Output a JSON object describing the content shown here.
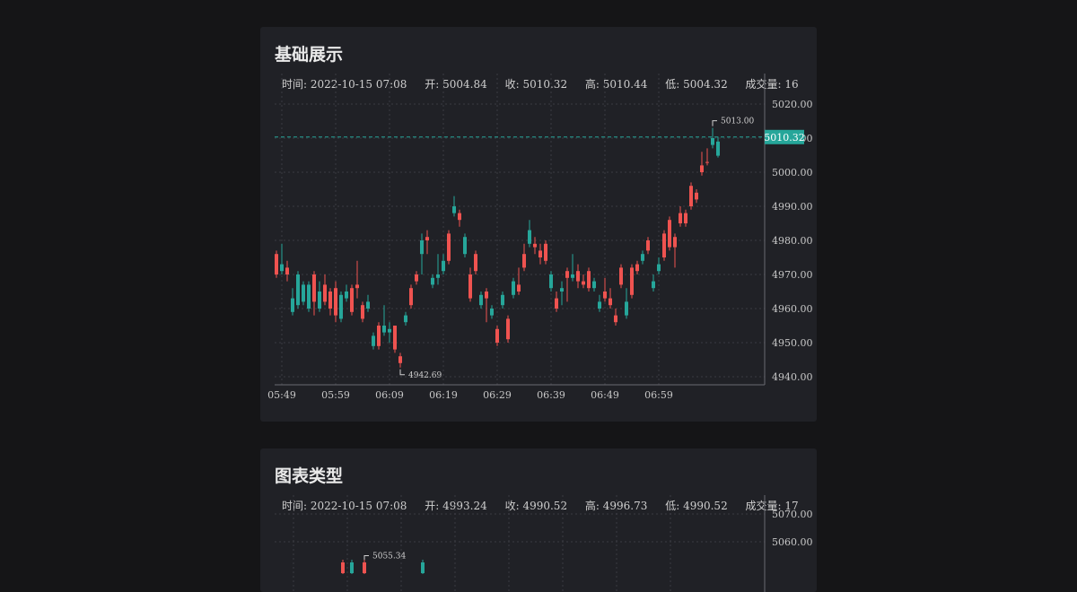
{
  "panels": [
    {
      "title": "基础展示",
      "tooltip": {
        "time": "时间: 2022-10-15 07:08",
        "open": "开: 5004.84",
        "close": "收: 5010.32",
        "high": "高: 5010.44",
        "low": "低: 5004.32",
        "volume": "成交量: 16"
      }
    },
    {
      "title": "图表类型",
      "tooltip": {
        "time": "时间: 2022-10-15 07:08",
        "open": "开: 4993.24",
        "close": "收: 4990.52",
        "high": "高: 4996.73",
        "low": "低: 4990.52",
        "volume": "成交量: 17"
      }
    }
  ],
  "chart_data": [
    {
      "type": "candlestick",
      "title": "基础展示",
      "ylim": [
        4935,
        5025
      ],
      "y_ticks": [
        4940,
        4950,
        4960,
        4970,
        4980,
        4990,
        5000,
        5010,
        5020
      ],
      "y_tick_labels": [
        "4940.00",
        "4950.00",
        "4960.00",
        "4970.00",
        "4980.00",
        "4990.00",
        "5000.00",
        "5010.00",
        "5020.00"
      ],
      "x_tick_labels": [
        "05:49",
        "05:59",
        "06:09",
        "06:19",
        "06:29",
        "06:39",
        "06:49",
        "06:59"
      ],
      "x_tick_index": [
        1,
        11,
        21,
        31,
        41,
        51,
        61,
        71
      ],
      "last_price": 5010.32,
      "last_price_label": "5010.32",
      "max_label": "5013.00",
      "max_index": 81,
      "max_value": 5013.0,
      "min_label": "4942.69",
      "min_index": 23,
      "min_value": 4942.69,
      "up_color": "#ef5350",
      "down_color": "#26a69a",
      "candles": [
        {
          "o": 4970,
          "c": 4976,
          "h": 4977,
          "l": 4969
        },
        {
          "o": 4973,
          "c": 4971,
          "h": 4979,
          "l": 4970
        },
        {
          "o": 4970,
          "c": 4972,
          "h": 4974,
          "l": 4968
        },
        {
          "o": 4963,
          "c": 4959,
          "h": 4966,
          "l": 4958
        },
        {
          "o": 4970,
          "c": 4961,
          "h": 4971,
          "l": 4960
        },
        {
          "o": 4967,
          "c": 4962,
          "h": 4968,
          "l": 4961
        },
        {
          "o": 4967,
          "c": 4960,
          "h": 4968,
          "l": 4959
        },
        {
          "o": 4962,
          "c": 4970,
          "h": 4971,
          "l": 4958
        },
        {
          "o": 4965,
          "c": 4960,
          "h": 4968,
          "l": 4959
        },
        {
          "o": 4962,
          "c": 4967,
          "h": 4970,
          "l": 4961
        },
        {
          "o": 4960,
          "c": 4965,
          "h": 4966,
          "l": 4958
        },
        {
          "o": 4958,
          "c": 4966,
          "h": 4968,
          "l": 4956
        },
        {
          "o": 4964,
          "c": 4957,
          "h": 4965,
          "l": 4956
        },
        {
          "o": 4965,
          "c": 4963,
          "h": 4967,
          "l": 4962
        },
        {
          "o": 4959,
          "c": 4966,
          "h": 4967,
          "l": 4958
        },
        {
          "o": 4966,
          "c": 4967,
          "h": 4974,
          "l": 4963
        },
        {
          "o": 4957,
          "c": 4961,
          "h": 4962,
          "l": 4956
        },
        {
          "o": 4962,
          "c": 4960,
          "h": 4964,
          "l": 4959
        },
        {
          "o": 4952,
          "c": 4949,
          "h": 4953,
          "l": 4948
        },
        {
          "o": 4949,
          "c": 4955,
          "h": 4956,
          "l": 4948
        },
        {
          "o": 4955,
          "c": 4953,
          "h": 4961,
          "l": 4952
        },
        {
          "o": 4954,
          "c": 4953,
          "h": 4956,
          "l": 4950
        },
        {
          "o": 4948,
          "c": 4955,
          "h": 4955,
          "l": 4947
        },
        {
          "o": 4944,
          "c": 4946,
          "h": 4947,
          "l": 4942.69
        },
        {
          "o": 4958,
          "c": 4956,
          "h": 4959,
          "l": 4955
        },
        {
          "o": 4961,
          "c": 4966,
          "h": 4967,
          "l": 4960
        },
        {
          "o": 4968,
          "c": 4970,
          "h": 4971,
          "l": 4967
        },
        {
          "o": 4980,
          "c": 4976,
          "h": 4982,
          "l": 4970
        },
        {
          "o": 4980,
          "c": 4981,
          "h": 4983,
          "l": 4976
        },
        {
          "o": 4969,
          "c": 4967,
          "h": 4970,
          "l": 4966
        },
        {
          "o": 4970,
          "c": 4969,
          "h": 4976,
          "l": 4967
        },
        {
          "o": 4974,
          "c": 4971,
          "h": 4976,
          "l": 4970
        },
        {
          "o": 4974,
          "c": 4982,
          "h": 4983,
          "l": 4973
        },
        {
          "o": 4990,
          "c": 4988,
          "h": 4993,
          "l": 4987
        },
        {
          "o": 4986,
          "c": 4988,
          "h": 4989,
          "l": 4984
        },
        {
          "o": 4981,
          "c": 4976,
          "h": 4982,
          "l": 4975
        },
        {
          "o": 4963,
          "c": 4970,
          "h": 4972,
          "l": 4962
        },
        {
          "o": 4971,
          "c": 4976,
          "h": 4977,
          "l": 4970
        },
        {
          "o": 4964,
          "c": 4961,
          "h": 4965,
          "l": 4960
        },
        {
          "o": 4963,
          "c": 4965,
          "h": 4966,
          "l": 4956
        },
        {
          "o": 4960,
          "c": 4958,
          "h": 4961,
          "l": 4957
        },
        {
          "o": 4950,
          "c": 4954,
          "h": 4955,
          "l": 4949
        },
        {
          "o": 4964,
          "c": 4961,
          "h": 4965,
          "l": 4960
        },
        {
          "o": 4951,
          "c": 4957,
          "h": 4958,
          "l": 4950
        },
        {
          "o": 4968,
          "c": 4964,
          "h": 4969,
          "l": 4963
        },
        {
          "o": 4965,
          "c": 4967,
          "h": 4972,
          "l": 4964
        },
        {
          "o": 4972,
          "c": 4976,
          "h": 4979,
          "l": 4971
        },
        {
          "o": 4983,
          "c": 4979,
          "h": 4986,
          "l": 4978
        },
        {
          "o": 4978,
          "c": 4979,
          "h": 4981,
          "l": 4976
        },
        {
          "o": 4975,
          "c": 4977,
          "h": 4979,
          "l": 4973
        },
        {
          "o": 4974,
          "c": 4979,
          "h": 4980,
          "l": 4973
        },
        {
          "o": 4970,
          "c": 4966,
          "h": 4971,
          "l": 4965
        },
        {
          "o": 4960,
          "c": 4963,
          "h": 4965,
          "l": 4959
        },
        {
          "o": 4966,
          "c": 4965,
          "h": 4968,
          "l": 4961
        },
        {
          "o": 4969,
          "c": 4971,
          "h": 4972,
          "l": 4962
        },
        {
          "o": 4970,
          "c": 4969,
          "h": 4976,
          "l": 4968
        },
        {
          "o": 4968,
          "c": 4971,
          "h": 4973,
          "l": 4966
        },
        {
          "o": 4967,
          "c": 4968,
          "h": 4970,
          "l": 4966
        },
        {
          "o": 4966,
          "c": 4971,
          "h": 4972,
          "l": 4965
        },
        {
          "o": 4968,
          "c": 4966,
          "h": 4969,
          "l": 4965
        },
        {
          "o": 4962,
          "c": 4960,
          "h": 4964,
          "l": 4959
        },
        {
          "o": 4963,
          "c": 4965,
          "h": 4969,
          "l": 4962
        },
        {
          "o": 4961,
          "c": 4963,
          "h": 4966,
          "l": 4960
        },
        {
          "o": 4956,
          "c": 4958,
          "h": 4960,
          "l": 4955
        },
        {
          "o": 4967,
          "c": 4972,
          "h": 4973,
          "l": 4966
        },
        {
          "o": 4962,
          "c": 4958,
          "h": 4966,
          "l": 4957
        },
        {
          "o": 4964,
          "c": 4972,
          "h": 4973,
          "l": 4963
        },
        {
          "o": 4971,
          "c": 4973,
          "h": 4974,
          "l": 4970
        },
        {
          "o": 4976,
          "c": 4974,
          "h": 4977,
          "l": 4973
        },
        {
          "o": 4977,
          "c": 4980,
          "h": 4981,
          "l": 4976
        },
        {
          "o": 4968,
          "c": 4966,
          "h": 4970,
          "l": 4965
        },
        {
          "o": 4973,
          "c": 4971,
          "h": 4975,
          "l": 4970
        },
        {
          "o": 4975,
          "c": 4982,
          "h": 4983,
          "l": 4974
        },
        {
          "o": 4978,
          "c": 4986,
          "h": 4987,
          "l": 4977
        },
        {
          "o": 4978,
          "c": 4981,
          "h": 4982,
          "l": 4972
        },
        {
          "o": 4985,
          "c": 4988,
          "h": 4990,
          "l": 4984
        },
        {
          "o": 4985,
          "c": 4988,
          "h": 4989,
          "l": 4984
        },
        {
          "o": 4990,
          "c": 4996,
          "h": 4997,
          "l": 4989
        },
        {
          "o": 4992,
          "c": 4994,
          "h": 4995,
          "l": 4991
        },
        {
          "o": 5000,
          "c": 5002,
          "h": 5006,
          "l": 4999
        },
        {
          "o": 5003,
          "c": 5003,
          "h": 5007,
          "l": 5002
        },
        {
          "o": 5010,
          "c": 5008,
          "h": 5013.0,
          "l": 5007
        },
        {
          "o": 5009,
          "c": 5004.84,
          "h": 5010.44,
          "l": 5004.32
        }
      ]
    },
    {
      "type": "candlestick",
      "title": "图表类型",
      "ylim": [
        5040,
        5075
      ],
      "y_ticks": [
        5060,
        5070
      ],
      "y_tick_labels": [
        "5060.00",
        "5070.00"
      ],
      "max_label": "5055.34"
    }
  ]
}
